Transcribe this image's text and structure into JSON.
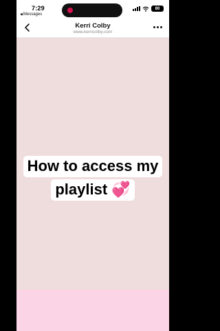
{
  "status_bar": {
    "time": "7:29",
    "back_app": "Messages",
    "battery": "80"
  },
  "nav": {
    "title": "Kerri Colby",
    "url": "www.kerricolby.com"
  },
  "caption": {
    "line1": "How to access my",
    "line2": "playlist 💞"
  },
  "colors": {
    "content_bg": "#efdcdd",
    "footer_bg": "#fbd4e5",
    "island_dot": "#d6124e"
  },
  "icons": [
    "back-chevron-icon",
    "more-icon",
    "signal-icon",
    "wifi-icon",
    "battery-icon"
  ]
}
